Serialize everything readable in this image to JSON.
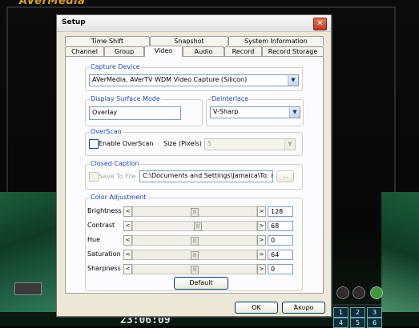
{
  "background": {
    "app_logo": "AVerMedia",
    "clock": "23:06:09",
    "keypad": [
      "1",
      "2",
      "3",
      "4",
      "5",
      "6"
    ]
  },
  "dialog": {
    "title": "Setup",
    "close_glyph": "✕",
    "tabs_row1": [
      {
        "label": "Time Shift"
      },
      {
        "label": "Snapshot"
      },
      {
        "label": "System Information"
      }
    ],
    "tabs_row2": [
      {
        "label": "Channel"
      },
      {
        "label": "Group"
      },
      {
        "label": "Video",
        "active": true
      },
      {
        "label": "Audio"
      },
      {
        "label": "Record"
      },
      {
        "label": "Record Storage"
      }
    ],
    "capture_device": {
      "title": "Capture Device",
      "value": "AVerMedia, AVerTV WDM Video Capture (Silicon)"
    },
    "display_surface": {
      "title": "Display Surface Mode",
      "value": "Overlay"
    },
    "deinterlace": {
      "title": "Deinterlace",
      "value": "V-Sharp"
    },
    "overscan": {
      "title": "OverScan",
      "checkbox_label": "Enable OverScan",
      "checked": false,
      "size_label": "Size (Pixels)",
      "size_value": "5"
    },
    "closed_caption": {
      "title": "Closed Caption",
      "checkbox_label": "Save To File",
      "path": "C:\\Documents and Settings\\Jamaica\\To: έγγ",
      "browse_label": "..."
    },
    "color_adjustment": {
      "title": "Color Adjustment",
      "left_arrow": "<",
      "right_arrow": ">",
      "thumb_glyph": "|||",
      "sliders": [
        {
          "label": "Brightness",
          "value": "128",
          "fraction": 0.5
        },
        {
          "label": "Contrast",
          "value": "68",
          "fraction": 0.53
        },
        {
          "label": "Hue",
          "value": "0",
          "fraction": 0.5
        },
        {
          "label": "Saturation",
          "value": "64",
          "fraction": 0.5
        },
        {
          "label": "Sharpness",
          "value": "0",
          "fraction": 0.5
        }
      ],
      "default_label": "Default"
    },
    "ok_label": "OK",
    "cancel_label": "Άκυρο"
  }
}
